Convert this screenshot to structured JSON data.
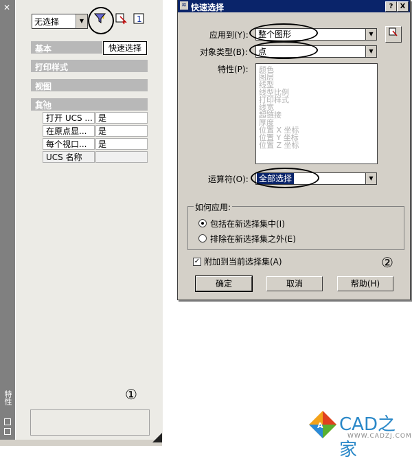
{
  "palette": {
    "vertical_title": "特性",
    "selection_combo": "无选择",
    "tooltip": "快速选择",
    "categories": [
      {
        "label": "基本",
        "chevron": "⌄⌄"
      },
      {
        "label": "打印样式",
        "chevron": "⌄⌄"
      },
      {
        "label": "视图",
        "chevron": "⌄⌄"
      },
      {
        "label": "其他",
        "chevron": "⌃⌃"
      }
    ],
    "rows": [
      {
        "key": "打开 UCS ...",
        "value": "是"
      },
      {
        "key": "在原点显...",
        "value": "是"
      },
      {
        "key": "每个视口...",
        "value": "是"
      },
      {
        "key": "UCS 名称",
        "value": ""
      }
    ],
    "marker": "①"
  },
  "dialog": {
    "title": "快速选择",
    "help_btn": "?",
    "close_btn": "X",
    "apply_to_label": "应用到(Y):",
    "apply_to_value": "整个图形",
    "object_type_label": "对象类型(B):",
    "object_type_value": "点",
    "properties_label": "特性(P):",
    "properties": [
      "颜色",
      "图层",
      "线型",
      "线型比例",
      "打印样式",
      "线宽",
      "超链接",
      "厚度",
      "位置 X 坐标",
      "位置 Y 坐标",
      "位置 Z 坐标"
    ],
    "operator_label": "运算符(O):",
    "operator_value": "全部选择",
    "how_apply_label": "如何应用:",
    "radio_include": "包括在新选择集中(I)",
    "radio_exclude": "排除在新选择集之外(E)",
    "append_label": "附加到当前选择集(A)",
    "ok": "确定",
    "cancel": "取消",
    "help": "帮助(H)",
    "marker": "②"
  },
  "watermark": {
    "brand": "CAD之家",
    "url": "WWW.CADZJ.COM"
  }
}
